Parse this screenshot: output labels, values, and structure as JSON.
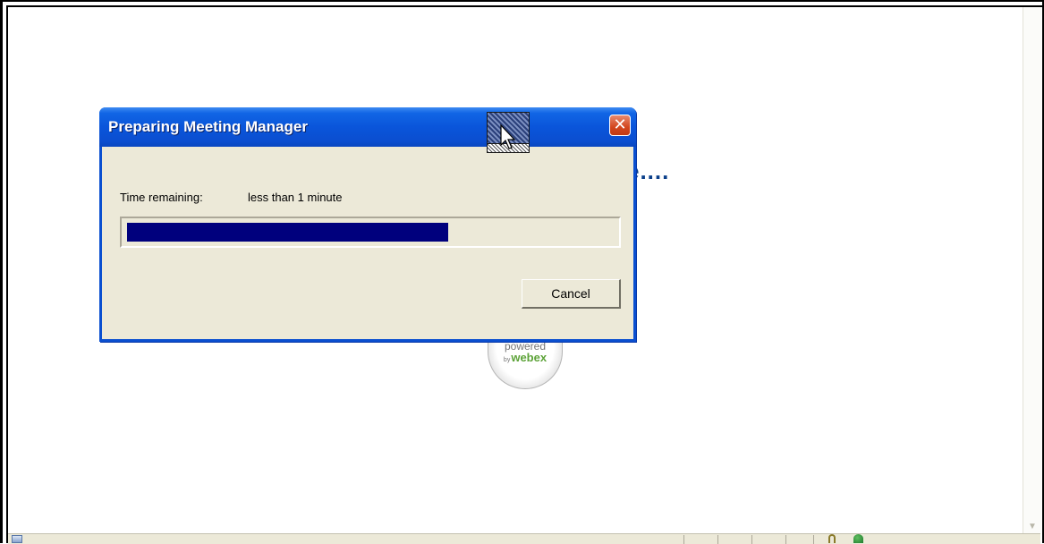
{
  "background_page": {
    "loading_text": "e....",
    "logo": {
      "powered_text": "powered",
      "by_text": "by",
      "brand_text": "webex",
      "brand_color": "#5da339"
    }
  },
  "dialog": {
    "title": "Preparing Meeting Manager",
    "close_icon": "close-icon",
    "time_remaining_label": "Time remaining:",
    "time_remaining_value": "less than 1 minute",
    "progress_fraction": 0.66,
    "progress_color": "#00007d",
    "cancel_label": "Cancel"
  },
  "colors": {
    "titlebar_blue": "#0a55da",
    "dialog_face": "#ece9d8",
    "loading_text_color": "#0a3f8a"
  }
}
